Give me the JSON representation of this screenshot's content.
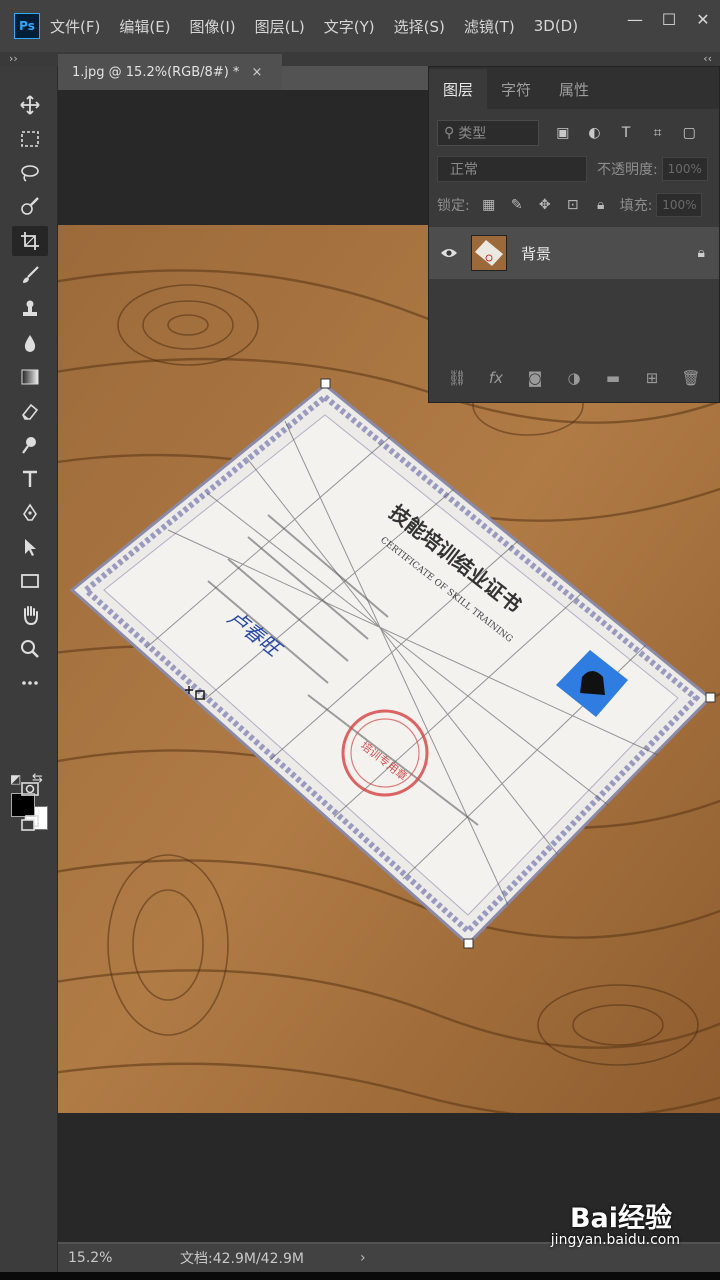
{
  "app": {
    "logo": "Ps"
  },
  "menu": [
    "文件(F)",
    "编辑(E)",
    "图像(I)",
    "图层(L)",
    "文字(Y)",
    "选择(S)",
    "滤镜(T)",
    "3D(D)"
  ],
  "window_controls": {
    "minimize": "—",
    "maximize": "☐",
    "close": "✕"
  },
  "document_tab": {
    "title": "1.jpg @ 15.2%(RGB/8#) *",
    "close": "×"
  },
  "layers_panel": {
    "tabs": [
      "图层",
      "字符",
      "属性"
    ],
    "filter_placeholder": "类型",
    "blend_mode": "正常",
    "opacity_label": "不透明度:",
    "opacity_value": "100%",
    "lock_label": "锁定:",
    "fill_label": "填充:",
    "fill_value": "100%",
    "layer": {
      "name": "背景"
    },
    "footer_fx": "fx"
  },
  "status": {
    "zoom": "15.2%",
    "doc_info": "文档:42.9M/42.9M",
    "arrow": "›"
  },
  "watermark": {
    "brand": "Bai经验",
    "url": "jingyan.baidu.com"
  },
  "certificate": {
    "title": "技能培训结业证书",
    "subtitle": "CERTIFICATE OF SKILL TRAINING",
    "signature": "卢春旺",
    "seal": "培训专用章"
  }
}
